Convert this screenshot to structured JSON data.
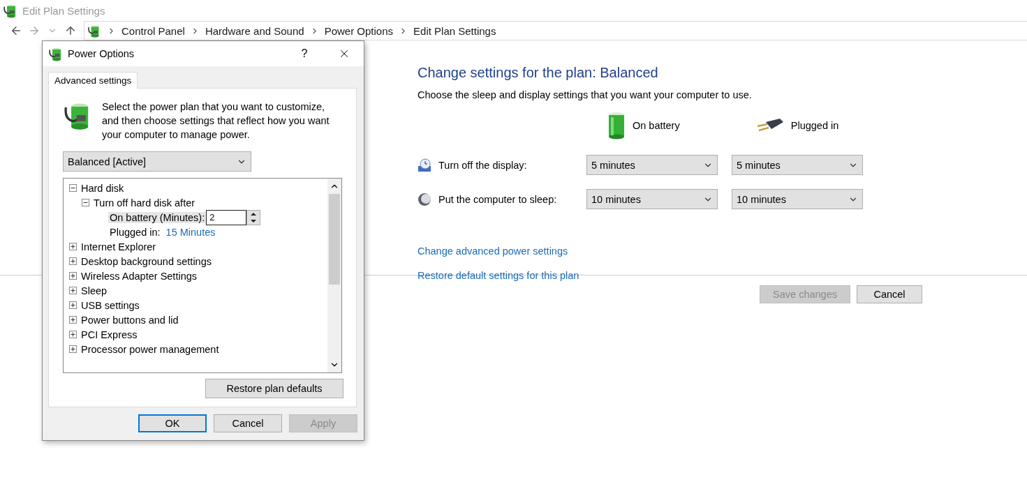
{
  "window": {
    "title": "Edit Plan Settings"
  },
  "breadcrumb": [
    "Control Panel",
    "Hardware and Sound",
    "Power Options",
    "Edit Plan Settings"
  ],
  "plan": {
    "heading": "Change settings for the plan: Balanced",
    "description": "Choose the sleep and display settings that you want your computer to use.",
    "columns": [
      {
        "kind": "battery",
        "label": "On battery"
      },
      {
        "kind": "plug",
        "label": "Plugged in"
      }
    ],
    "settings": [
      {
        "kind": "display",
        "label": "Turn off the display:",
        "values": [
          "5 minutes",
          "5 minutes"
        ]
      },
      {
        "kind": "sleep",
        "label": "Put the computer to sleep:",
        "values": [
          "10 minutes",
          "10 minutes"
        ]
      }
    ],
    "links": [
      "Change advanced power settings",
      "Restore default settings for this plan"
    ]
  },
  "footer_buttons": [
    {
      "label": "Save changes",
      "disabled": true
    },
    {
      "label": "Cancel",
      "disabled": false
    }
  ],
  "dialog": {
    "title": "Power Options",
    "help": "?",
    "tabs": [
      {
        "label": "Advanced settings",
        "selected": true
      }
    ],
    "intro": "Select the power plan that you want to customize, and then choose settings that reflect how you want your computer to manage power.",
    "plan_select": "Balanced [Active]",
    "tree": [
      {
        "label": "Hard disk",
        "expanded": true,
        "children": [
          {
            "label": "Turn off hard disk after",
            "expanded": true,
            "children": [
              {
                "kind": "spin",
                "label": "On battery (Minutes):",
                "value": "2"
              },
              {
                "kind": "value",
                "label": "Plugged in:",
                "value": "15 Minutes"
              }
            ]
          }
        ]
      },
      {
        "label": "Internet Explorer",
        "expanded": false
      },
      {
        "label": "Desktop background settings",
        "expanded": false
      },
      {
        "label": "Wireless Adapter Settings",
        "expanded": false
      },
      {
        "label": "Sleep",
        "expanded": false
      },
      {
        "label": "USB settings",
        "expanded": false
      },
      {
        "label": "Power buttons and lid",
        "expanded": false
      },
      {
        "label": "PCI Express",
        "expanded": false
      },
      {
        "label": "Processor power management",
        "expanded": false
      }
    ],
    "restore_button": "Restore plan defaults",
    "buttons": [
      {
        "label": "OK",
        "default": true,
        "disabled": false
      },
      {
        "label": "Cancel",
        "default": false,
        "disabled": false
      },
      {
        "label": "Apply",
        "default": false,
        "disabled": true
      }
    ]
  }
}
